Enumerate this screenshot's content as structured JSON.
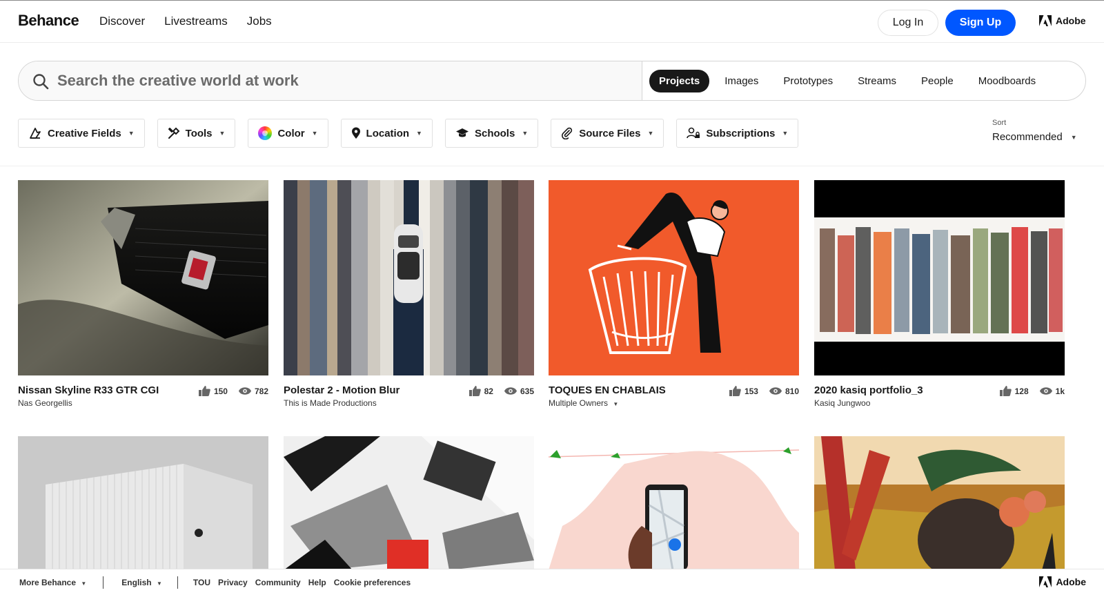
{
  "header": {
    "logo": "Behance",
    "nav": [
      "Discover",
      "Livestreams",
      "Jobs"
    ],
    "login": "Log In",
    "signup": "Sign Up",
    "adobe": "Adobe"
  },
  "search": {
    "placeholder": "Search the creative world at work",
    "tabs": [
      "Projects",
      "Images",
      "Prototypes",
      "Streams",
      "People",
      "Moodboards"
    ],
    "active_tab": "Projects"
  },
  "filters": {
    "creative_fields": "Creative Fields",
    "tools": "Tools",
    "color": "Color",
    "location": "Location",
    "schools": "Schools",
    "source_files": "Source Files",
    "subscriptions": "Subscriptions"
  },
  "sort": {
    "label": "Sort",
    "value": "Recommended"
  },
  "projects": [
    {
      "title": "Nissan Skyline R33 GTR CGI",
      "owner": "Nas Georgellis",
      "likes": "150",
      "views": "782"
    },
    {
      "title": "Polestar 2 - Motion Blur",
      "owner": "This is Made Productions",
      "likes": "82",
      "views": "635"
    },
    {
      "title": "TOQUES EN CHABLAIS",
      "owner": "Multiple Owners",
      "likes": "153",
      "views": "810"
    },
    {
      "title": "2020 kasiq portfolio_3",
      "owner": "Kasiq Jungwoo",
      "likes": "128",
      "views": "1k"
    }
  ],
  "footer": {
    "more": "More Behance",
    "language": "English",
    "links": [
      "TOU",
      "Privacy",
      "Community",
      "Help",
      "Cookie preferences"
    ],
    "adobe": "Adobe"
  },
  "colors": {
    "accent": "#0057ff",
    "toques_bg": "#f15a2b"
  }
}
